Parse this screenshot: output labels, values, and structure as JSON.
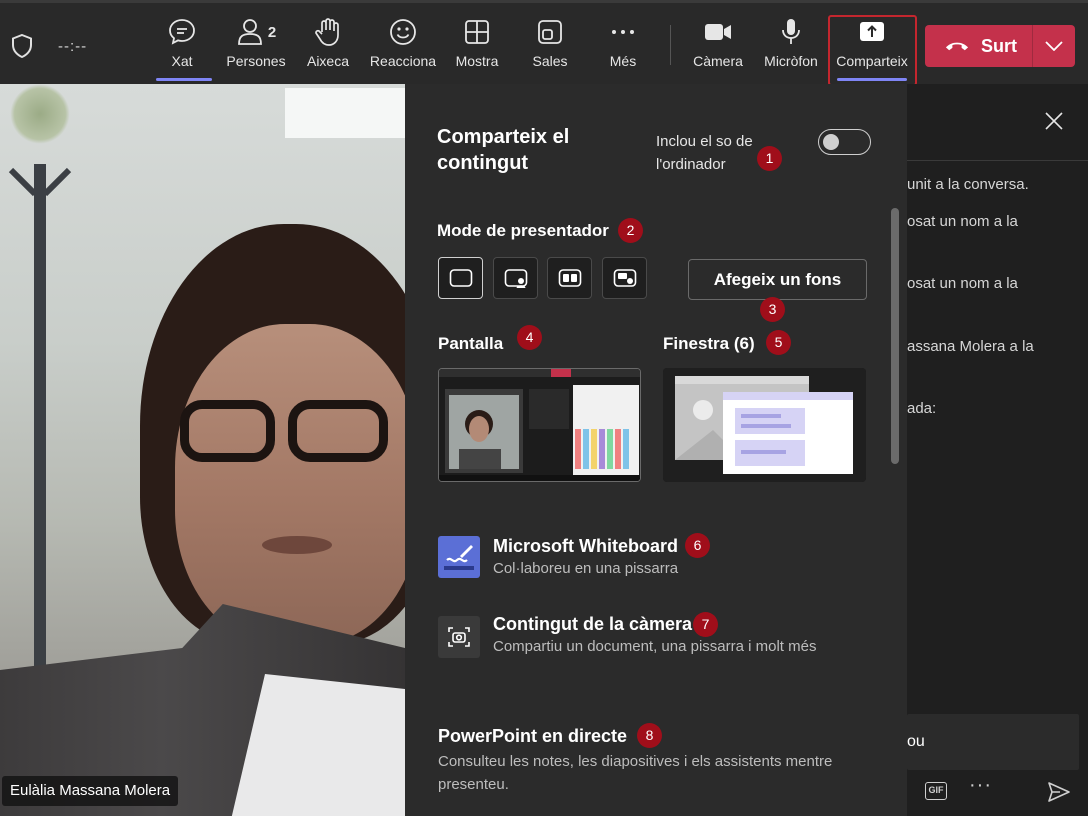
{
  "toolbar": {
    "timer": "--:--",
    "chat_label": "Xat",
    "people_label": "Persones",
    "people_count": "2",
    "raise_label": "Aixeca",
    "react_label": "Reacciona",
    "view_label": "Mostra",
    "rooms_label": "Sales",
    "more_label": "Més",
    "camera_label": "Càmera",
    "mic_label": "Micròfon",
    "share_label": "Comparteix",
    "leave_label": "Surt",
    "accent_color": "#7f85f5",
    "leave_color": "#c4314b"
  },
  "video": {
    "participant_name": "Eulàlia Massana Molera"
  },
  "share_panel": {
    "title": "Comparteix el contingut",
    "include_sound_label": "Inclou el so de l'ordinador",
    "include_sound_on": false,
    "presenter_mode_label": "Mode de presentador",
    "add_background_label": "Afegeix un fons",
    "screen_label": "Pantalla",
    "window_label": "Finestra (6)",
    "whiteboard_title": "Microsoft Whiteboard",
    "whiteboard_subtitle": "Col·laboreu en una pissarra",
    "camera_content_title": "Contingut de la càmera",
    "camera_content_subtitle": "Compartiu un document, una pissarra i molt més",
    "powerpoint_title": "PowerPoint en directe",
    "powerpoint_subtitle": "Consulteu les notes, les diapositives i els assistents mentre presenteu.",
    "badges": [
      "1",
      "2",
      "3",
      "4",
      "5",
      "6",
      "7",
      "8"
    ],
    "badge_color": "#a00e1a"
  },
  "chat": {
    "lines": [
      "unit a la conversa.",
      "osat un nom a la",
      "osat un nom a la",
      "assana Molera a la",
      "ada:"
    ],
    "input_text": "ou",
    "gif_label": "GIF"
  }
}
